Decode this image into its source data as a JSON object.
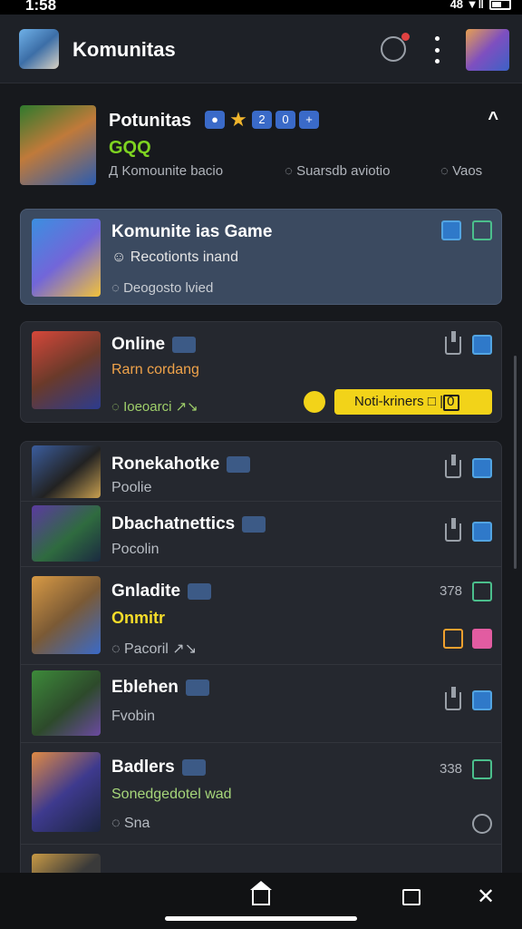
{
  "status_bar": {
    "time": "1:58",
    "signal_text": "48 ▼‖",
    "battery": "battery-icon"
  },
  "app_bar": {
    "title": "Komunitas",
    "icons": [
      "bug-report-icon",
      "more-vert-icon",
      "profile-avatar"
    ]
  },
  "profile": {
    "name": "Potunitas",
    "score": "GQQ",
    "meta": "Д Komounite bacio",
    "stat1": "◌ Suarsdb aviotio",
    "stat2": "◌ Vaos",
    "collapse_glyph": "^"
  },
  "cards": [
    {
      "title": "Komunite ias Game",
      "subtitle": "☺ Recotionts inand",
      "sub2": "◌ Deogosto lvied",
      "highlight": true
    },
    {
      "title": "Online",
      "subtitle": "Rarn cordang",
      "sub2": "◌ Ioeoarci ↗↘",
      "notify_label": "Noti-kriners □ | 0"
    }
  ],
  "list": [
    {
      "title": "Ronekahotke",
      "subtitle": "Poolie"
    },
    {
      "title": "Dbachatnettics",
      "subtitle": "Pocolin"
    },
    {
      "title": "Gnladite",
      "subtitle": "Onmitr",
      "sub2": "◌ Pacoril ↗↘",
      "count": "378"
    },
    {
      "title": "Eblehen",
      "subtitle": "Fvobin"
    },
    {
      "title": "Badlers",
      "subtitle": "Sonedgedotel wad",
      "sub2": "◌ Sna",
      "count": "338"
    }
  ],
  "colors": {
    "accent_blue": "#52a4e2",
    "accent_green": "#7ed321",
    "accent_yellow": "#f2d319",
    "background": "#17191d"
  }
}
